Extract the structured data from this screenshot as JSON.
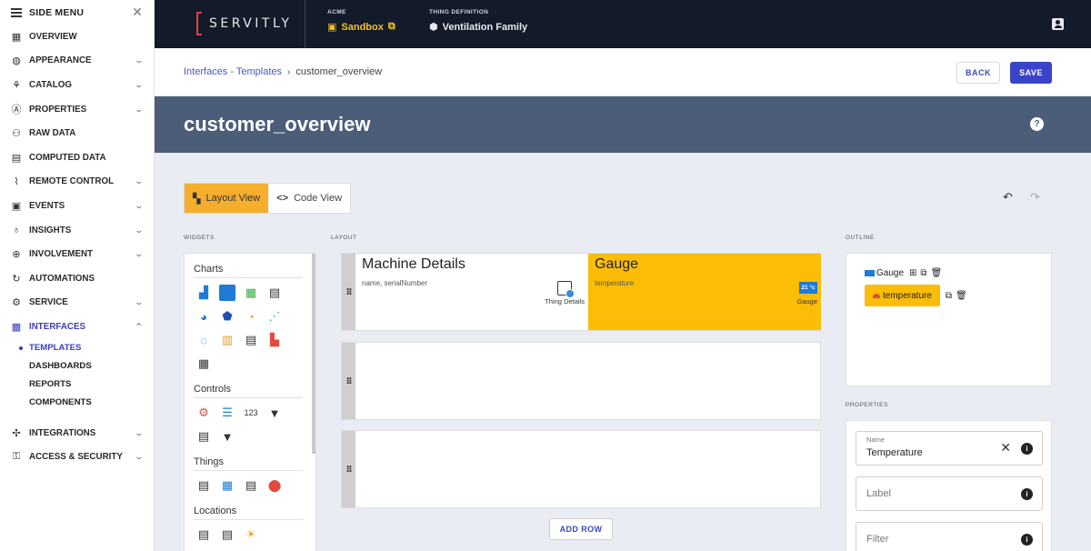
{
  "sidebar": {
    "title": "SIDE MENU",
    "items": [
      {
        "label": "OVERVIEW",
        "icon": "overview-icon"
      },
      {
        "label": "APPEARANCE",
        "icon": "palette-icon"
      },
      {
        "label": "CATALOG",
        "icon": "catalog-icon"
      },
      {
        "label": "PROPERTIES",
        "icon": "properties-icon"
      },
      {
        "label": "RAW DATA",
        "icon": "raw-data-icon"
      },
      {
        "label": "COMPUTED DATA",
        "icon": "computed-data-icon"
      },
      {
        "label": "REMOTE CONTROL",
        "icon": "remote-control-icon"
      },
      {
        "label": "EVENTS",
        "icon": "events-icon"
      },
      {
        "label": "INSIGHTS",
        "icon": "insights-icon"
      },
      {
        "label": "INVOLVEMENT",
        "icon": "involvement-icon"
      },
      {
        "label": "AUTOMATIONS",
        "icon": "automations-icon"
      },
      {
        "label": "SERVICE",
        "icon": "service-icon"
      },
      {
        "label": "INTERFACES",
        "icon": "interfaces-icon"
      },
      {
        "label": "INTEGRATIONS",
        "icon": "integrations-icon"
      },
      {
        "label": "ACCESS & SECURITY",
        "icon": "access-security-icon"
      }
    ],
    "sub_items": [
      "TEMPLATES",
      "DASHBOARDS",
      "REPORTS",
      "COMPONENTS"
    ]
  },
  "topbar": {
    "brand": "SERVITLY",
    "acme_label": "ACME",
    "acme_value": "Sandbox",
    "thing_label": "THING DEFINITION",
    "thing_value": "Ventilation Family"
  },
  "breadcrumb": {
    "link": "Interfaces - Templates",
    "separator": "›",
    "current": "customer_overview"
  },
  "actions": {
    "back": "BACK",
    "save": "SAVE"
  },
  "page": {
    "title": "customer_overview",
    "help": "?"
  },
  "view_tabs": {
    "layout": "Layout View",
    "code": "Code View"
  },
  "sections": {
    "widgets": "WIDGETS",
    "layout": "LAYOUT",
    "outline": "OUTLINE",
    "properties": "PROPERTIES"
  },
  "widget_groups": [
    {
      "title": "Charts"
    },
    {
      "title": "Controls"
    },
    {
      "title": "Things"
    },
    {
      "title": "Locations"
    }
  ],
  "layout": {
    "cell1_title": "Machine Details",
    "cell1_sub": "name, serialNumber",
    "cell1_widget": "Thing Details",
    "cell2_title": "Gauge",
    "cell2_sub": "temperature",
    "cell2_widget": "Gauge",
    "gauge_badge": "21 °c",
    "add_row": "ADD ROW"
  },
  "outline": {
    "node1": "Gauge",
    "node2": "temperature"
  },
  "properties": {
    "name_label": "Name",
    "name_value": "Temperature",
    "label_placeholder": "Label",
    "filter_placeholder": "Filter"
  },
  "colors": {
    "accent": "#3a44c9",
    "highlight": "#fbbd08",
    "topbar": "#131a2a",
    "titleband": "#4c5d79"
  }
}
